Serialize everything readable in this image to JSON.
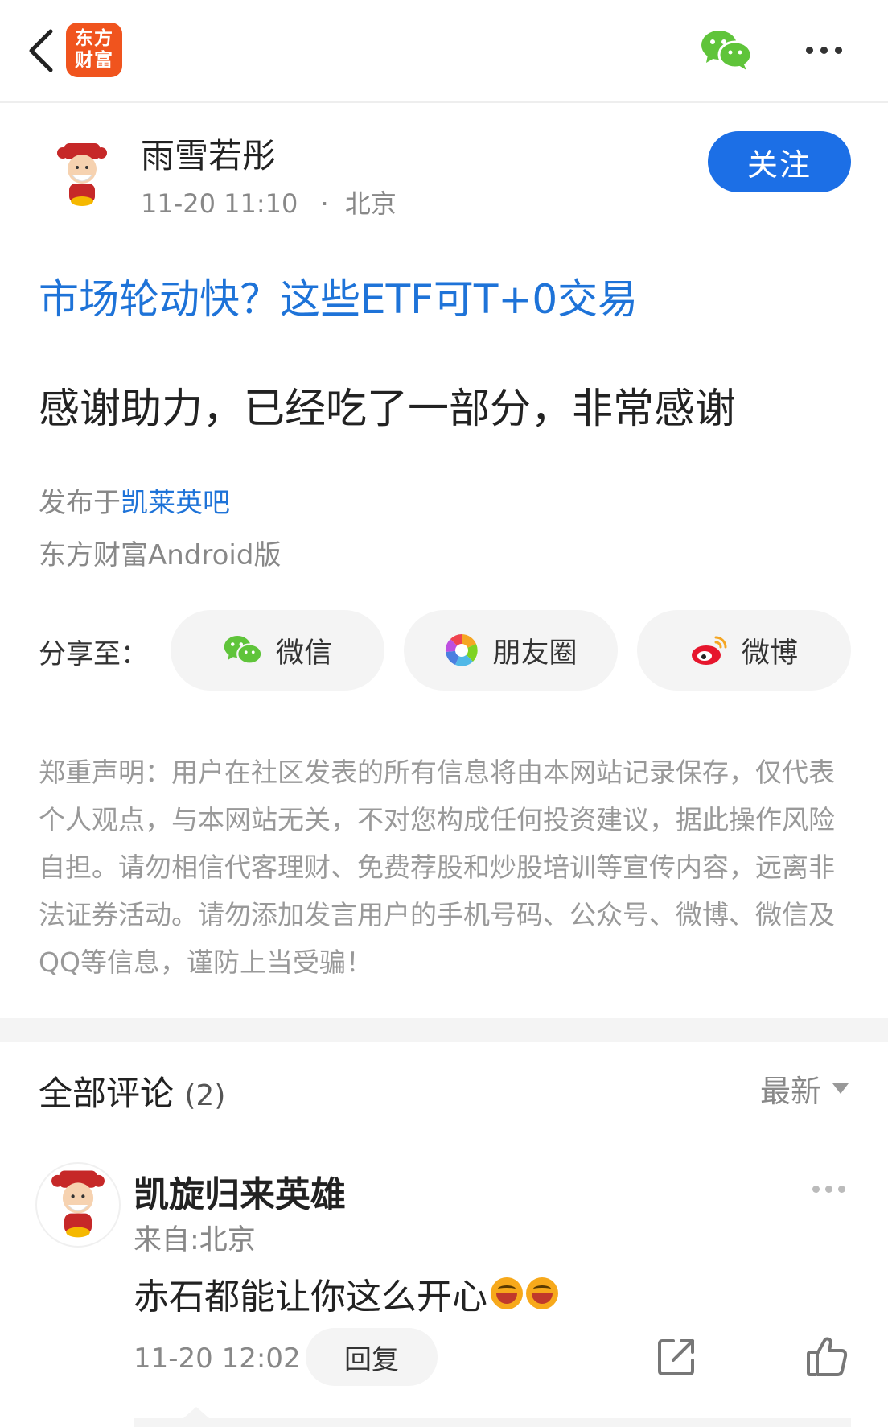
{
  "header": {
    "logo_line1": "东方",
    "logo_line2": "财富"
  },
  "author": {
    "name": "雨雪若彤",
    "time": "11-20 11:10",
    "separator": "·",
    "location": "北京",
    "follow_label": "关注"
  },
  "post": {
    "link_title": "市场轮动快？这些ETF可T+0交易",
    "body": "感谢助力，已经吃了一部分，非常感谢",
    "published_prefix": "发布于",
    "bar_name": "凯莱英吧",
    "client": "东方财富Android版"
  },
  "share": {
    "label": "分享至：",
    "wechat": "微信",
    "moments": "朋友圈",
    "weibo": "微博"
  },
  "disclaimer": "郑重声明：用户在社区发表的所有信息将由本网站记录保存，仅代表个人观点，与本网站无关，不对您构成任何投资建议，据此操作风险自担。请勿相信代客理财、免费荐股和炒股培训等宣传内容，远离非法证券活动。请勿添加发言用户的手机号码、公众号、微博、微信及QQ等信息，谨防上当受骗！",
  "comments": {
    "title": "全部评论",
    "count": "(2)",
    "sort": "最新",
    "items": [
      {
        "name": "凯旋归来英雄",
        "from": "来自:北京",
        "text": "赤石都能让你这么开心",
        "time": "11-20 12:02",
        "reply_label": "回复"
      }
    ]
  },
  "colors": {
    "accent": "#1c6fe6",
    "link": "#1e73d8",
    "logo": "#f0541e",
    "wechat": "#5fc43a"
  }
}
